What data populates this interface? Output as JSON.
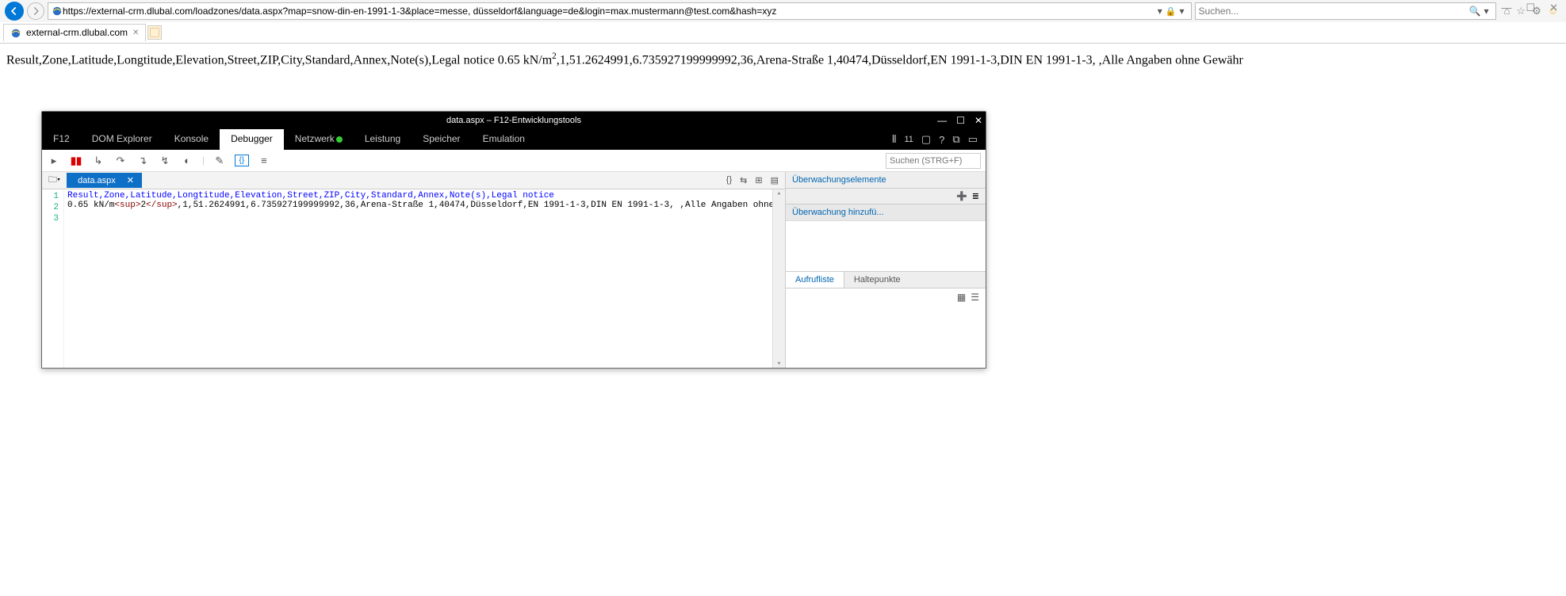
{
  "window_controls": {
    "minimize": "—",
    "maximize": "☐",
    "close": "✕"
  },
  "browser": {
    "url": "https://external-crm.dlubal.com/loadzones/data.aspx?map=snow-din-en-1991-1-3&place=messe, düsseldorf&language=de&login=max.mustermann@test.com&hash=xyz",
    "search_placeholder": "Suchen...",
    "tab_title": "external-crm.dlubal.com"
  },
  "page": {
    "text_before": "Result,Zone,Latitude,Longtitude,Elevation,Street,ZIP,City,Standard,Annex,Note(s),Legal notice 0.65 kN/m",
    "sup": "2",
    "text_after": ",1,51.2624991,6.735927199999992,36,Arena-Straße 1,40474,Düsseldorf,EN 1991-1-3,DIN EN 1991-1-3, ,Alle Angaben ohne Gewähr"
  },
  "devtools": {
    "title": "data.aspx – F12-Entwicklungstools",
    "f12": "F12",
    "tabs": {
      "dom": "DOM Explorer",
      "konsole": "Konsole",
      "debugger": "Debugger",
      "netzwerk": "Netzwerk",
      "leistung": "Leistung",
      "speicher": "Speicher",
      "emulation": "Emulation"
    },
    "right_badge": "11",
    "toolbar_search": "Suchen (STRG+F)",
    "file_tab": "data.aspx",
    "code": {
      "line1": "Result,Zone,Latitude,Longtitude,Elevation,Street,ZIP,City,Standard,Annex,Note(s),Legal notice",
      "line2_a": "0.65 kN/m",
      "line2_b": "<sup>",
      "line2_c": "2",
      "line2_d": "</sup>",
      "line2_e": ",1,51.2624991,6.735927199999992,36,Arena-Straße 1,40474,Düsseldorf,EN 1991-1-3,DIN EN 1991-1-3, ,Alle Angaben ohne Gewähr",
      "gutter": [
        "1",
        "2",
        "3"
      ]
    },
    "side": {
      "watch_header": "Überwachungselemente",
      "watch_add": "Überwachung hinzufü...",
      "callstack": "Aufrufliste",
      "breakpoints": "Haltepunkte"
    }
  }
}
